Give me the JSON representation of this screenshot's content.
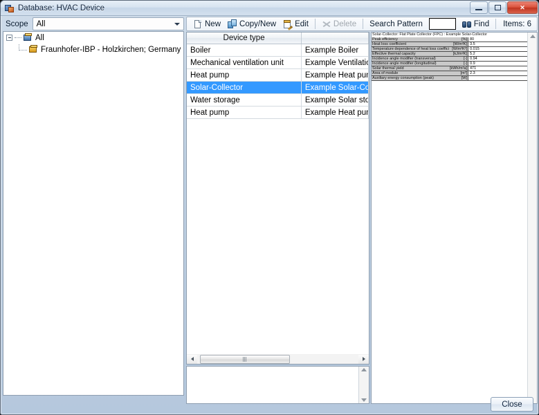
{
  "window": {
    "title": "Database: HVAC Device",
    "app_icon": "database-icon",
    "minimize_label": "",
    "restore_label": "",
    "close_label": "✕"
  },
  "scope": {
    "label": "Scope",
    "value": "All",
    "dropdown_icon": "chevron-down-icon"
  },
  "tree": {
    "root": {
      "label": "All",
      "icon": "database-root-icon"
    },
    "children": [
      {
        "label": "Fraunhofer-IBP - Holzkirchen; Germany",
        "icon": "database-node-icon"
      }
    ]
  },
  "toolbar": {
    "new_label": "New",
    "copy_new_label": "Copy/New",
    "edit_label": "Edit",
    "delete_label": "Delete",
    "search_pattern_label": "Search Pattern",
    "search_value": "",
    "search_placeholder": "",
    "find_label": "Find",
    "items_label": "Items: 6"
  },
  "device_list": {
    "columns": [
      "Device type",
      ""
    ],
    "rows": [
      {
        "type": "Boiler",
        "name": "Example Boiler",
        "selected": false
      },
      {
        "type": "Mechanical ventilation unit",
        "name": "Example Ventilation unit",
        "selected": false
      },
      {
        "type": "Heat pump",
        "name": "Example Heat pump",
        "selected": false
      },
      {
        "type": "Solar-Collector",
        "name": "Example Solar-Collector",
        "selected": true
      },
      {
        "type": "Water storage",
        "name": "Example Solar storage",
        "selected": false
      },
      {
        "type": "Heat pump",
        "name": "Example Heat pump",
        "selected": false
      }
    ]
  },
  "notes": {
    "value": ""
  },
  "properties": {
    "title": "Solar-Collector: Flat Plate Collector (FPC) : Example Solar-Collector",
    "rows": [
      {
        "name": "Peak efficiency",
        "unit": "[%]",
        "value": "80"
      },
      {
        "name": "Heat loss coefficient",
        "unit": "[W/m²K]",
        "value": "3.5"
      },
      {
        "name": "Temperature dependence of heat loss coefficient",
        "unit": "[W/m²K²]",
        "value": "0.015"
      },
      {
        "name": "Effective thermal capacity",
        "unit": "[kJ/m²K]",
        "value": "5.2"
      },
      {
        "name": "Incidence angle modifier (transversal)",
        "unit": "[-]",
        "value": "0.94"
      },
      {
        "name": "Incidence angle modifier (longitudinal)",
        "unit": "[-]",
        "value": "0.9"
      },
      {
        "name": "Solar thermal yield",
        "unit": "[kWh/m²a]",
        "value": "471"
      },
      {
        "name": "Area of module",
        "unit": "[m²]",
        "value": "2.3"
      },
      {
        "name": "Auxiliary energy consumption (peak)",
        "unit": "[W]",
        "value": ""
      }
    ]
  },
  "scrollbars": {
    "left_arrow_icon": "triangle-left-icon",
    "right_arrow_icon": "triangle-right-icon",
    "up_arrow_icon": "triangle-up-icon",
    "down_arrow_icon": "triangle-down-icon"
  },
  "footer": {
    "close_label": "Close"
  },
  "colors": {
    "selection": "#3399ff",
    "title_close": "#d9503a",
    "window_chrome": "#bfd0e2"
  }
}
